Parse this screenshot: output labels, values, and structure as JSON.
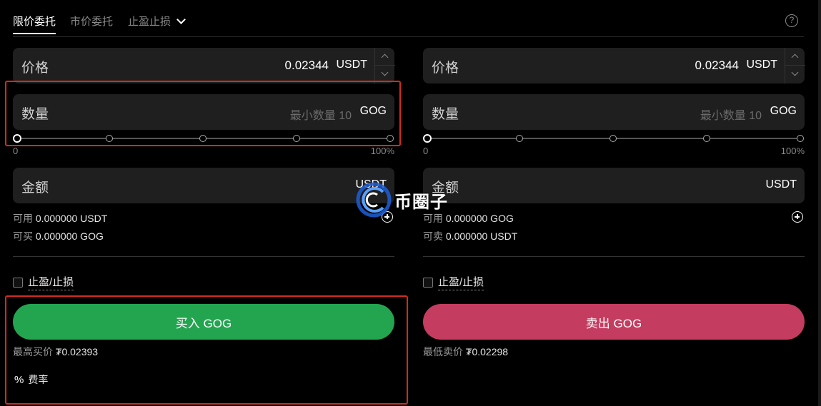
{
  "tabs": {
    "limit": "限价委托",
    "market": "市价委托",
    "tpsl": "止盈止损",
    "help": "?"
  },
  "buy": {
    "price_label": "价格",
    "price_value": "0.02344",
    "price_unit": "USDT",
    "qty_label": "数量",
    "qty_placeholder": "最小数量 10",
    "qty_unit": "GOG",
    "slider_min": "0",
    "slider_max": "100%",
    "slider_level": 0,
    "amount_label": "金额",
    "amount_unit": "USDT",
    "available_label": "可用",
    "available_value": "0.000000 USDT",
    "can_label": "可买",
    "can_value": "0.000000 GOG",
    "tpsl_label": "止盈/止损",
    "action_label": "买入 GOG",
    "best_label": "最高买价",
    "best_value": "₮0.02393",
    "fee_icon": "%",
    "fee_label": "费率"
  },
  "sell": {
    "price_label": "价格",
    "price_value": "0.02344",
    "price_unit": "USDT",
    "qty_label": "数量",
    "qty_placeholder": "最小数量 10",
    "qty_unit": "GOG",
    "slider_min": "0",
    "slider_max": "100%",
    "slider_level": 0,
    "amount_label": "金额",
    "amount_unit": "USDT",
    "available_label": "可用",
    "available_value": "0.000000 GOG",
    "can_label": "可卖",
    "can_value": "0.000000 USDT",
    "tpsl_label": "止盈/止损",
    "action_label": "卖出 GOG",
    "best_label": "最低卖价",
    "best_value": "₮0.02298"
  },
  "watermark": {
    "text": "币圈子"
  },
  "colors": {
    "buy": "#23a550",
    "sell": "#c43c5f",
    "highlight": "#d42a20",
    "field_bg": "#1f1f1f"
  }
}
